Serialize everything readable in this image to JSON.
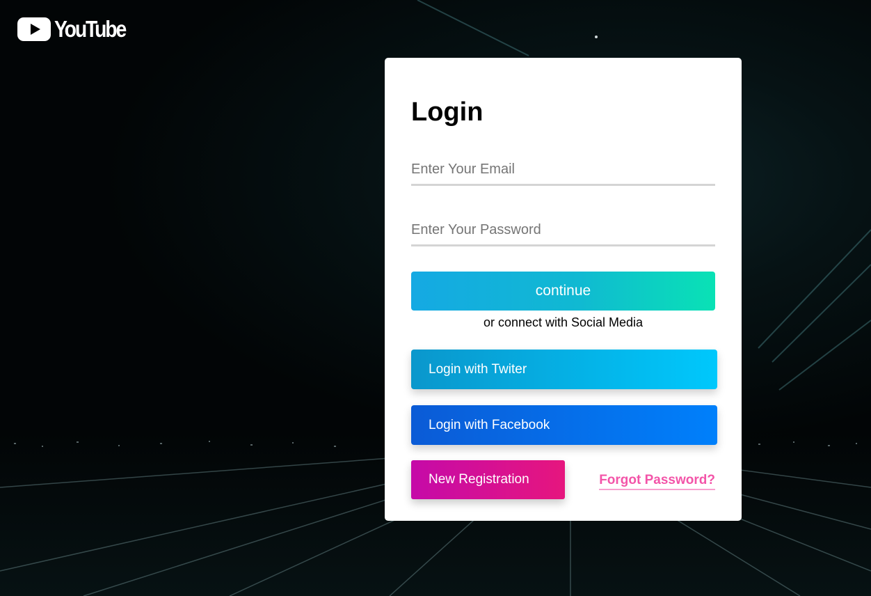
{
  "brand": {
    "name": "YouTube",
    "logo_icon": "youtube-play-icon"
  },
  "login": {
    "title": "Login",
    "email_placeholder": "Enter Your Email",
    "password_placeholder": "Enter Your Password",
    "continue_label": "continue",
    "social_note": "or connect with Social Media",
    "twitter_label": "Login with Twiter",
    "facebook_label": "Login with Facebook",
    "register_label": "New Registration",
    "forgot_label": "Forgot Password?"
  },
  "colors": {
    "continue_gradient": [
      "#15a9e3",
      "#09e2b5"
    ],
    "twitter_gradient": [
      "#0a97cc",
      "#00c8fc"
    ],
    "facebook_gradient": [
      "#0b5bd6",
      "#0080fb"
    ],
    "register_gradient": [
      "#c50aa8",
      "#e6167e"
    ],
    "forgot_link": "#f354a8",
    "background": "#020506"
  }
}
